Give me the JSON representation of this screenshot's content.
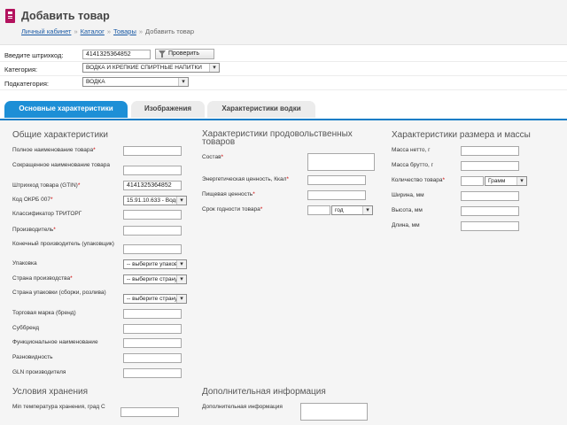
{
  "header": {
    "title": "Добавить товар",
    "breadcrumb": [
      "Личный кабинет",
      "Каталог",
      "Товары",
      "Добавить товар"
    ],
    "breadcrumb_sep": "»"
  },
  "top_form": {
    "barcode_label": "Введите штрихкод:",
    "barcode_value": "4141325364852",
    "check_button": "Проверить",
    "category_label": "Категория:",
    "category_value": "ВОДКА И КРЕПКИЕ СПИРТНЫЕ НАПИТКИ",
    "subcategory_label": "Подкатегория:",
    "subcategory_value": "ВОДКА"
  },
  "tabs": [
    "Основные характеристики",
    "Изображения",
    "Характеристики водки"
  ],
  "sections": {
    "general": "Общие характеристики",
    "food": "Характеристики продовольственных товаров",
    "size": "Характеристики размера и массы",
    "storage": "Условия хранения",
    "additional": "Дополнительная информация"
  },
  "general_fields": {
    "full_name": "Полное наименование товара",
    "short_name": "Сокращенное наименование товара",
    "gtin": "Штрихкод товара (GTIN)",
    "gtin_value": "4141325364852",
    "okpd": "Код ОКРБ 007",
    "okpd_value": "15.91.10.633 - Водк",
    "tritorg": "Классификатор ТРИТОРГ",
    "producer": "Производитель",
    "end_producer": "Конечный производитель (упаковщик)",
    "package": "Упаковка",
    "package_value": "-- выберите упаков",
    "country": "Страна производства",
    "country_value": "-- выберите страну",
    "pack_country": "Страна упаковки (сборки, розлива)",
    "pack_country_value": "-- выберите страну",
    "brand": "Торговая марка (бренд)",
    "subbrand": "Суббренд",
    "func_name": "Функциональное наименование",
    "variety": "Разновидность",
    "gln": "GLN производителя"
  },
  "food_fields": {
    "composition": "Состав",
    "energy": "Энергетическая ценность, Ккал",
    "nutrition": "Пищевая ценность",
    "shelf_life": "Срок годности товара",
    "shelf_unit": "год"
  },
  "size_fields": {
    "net": "Масса нетто, г",
    "gross": "Масса брутто, г",
    "quantity": "Количество товара",
    "quantity_unit": "Грамм",
    "width": "Ширина, мм",
    "height": "Высота, мм",
    "length": "Длина, мм"
  },
  "storage_fields": {
    "min_temp": "Min температура хранения, град С"
  },
  "additional_fields": {
    "info": "Дополнительная информация"
  },
  "colors": {
    "accent": "#1d8fd6",
    "tab_border": "#0e7cc6",
    "logo": "#b3125e",
    "required": "#cc0000"
  }
}
